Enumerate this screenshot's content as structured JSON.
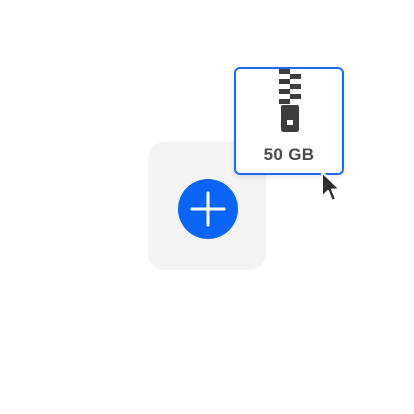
{
  "upload_tile": {
    "add_button_icon": "plus-icon",
    "accent_color": "#0b66f7"
  },
  "file_card": {
    "icon": "zip-file-icon",
    "size_label": "50 GB",
    "border_color": "#1c6cf3"
  },
  "cursor": {
    "icon": "mouse-pointer-icon"
  }
}
